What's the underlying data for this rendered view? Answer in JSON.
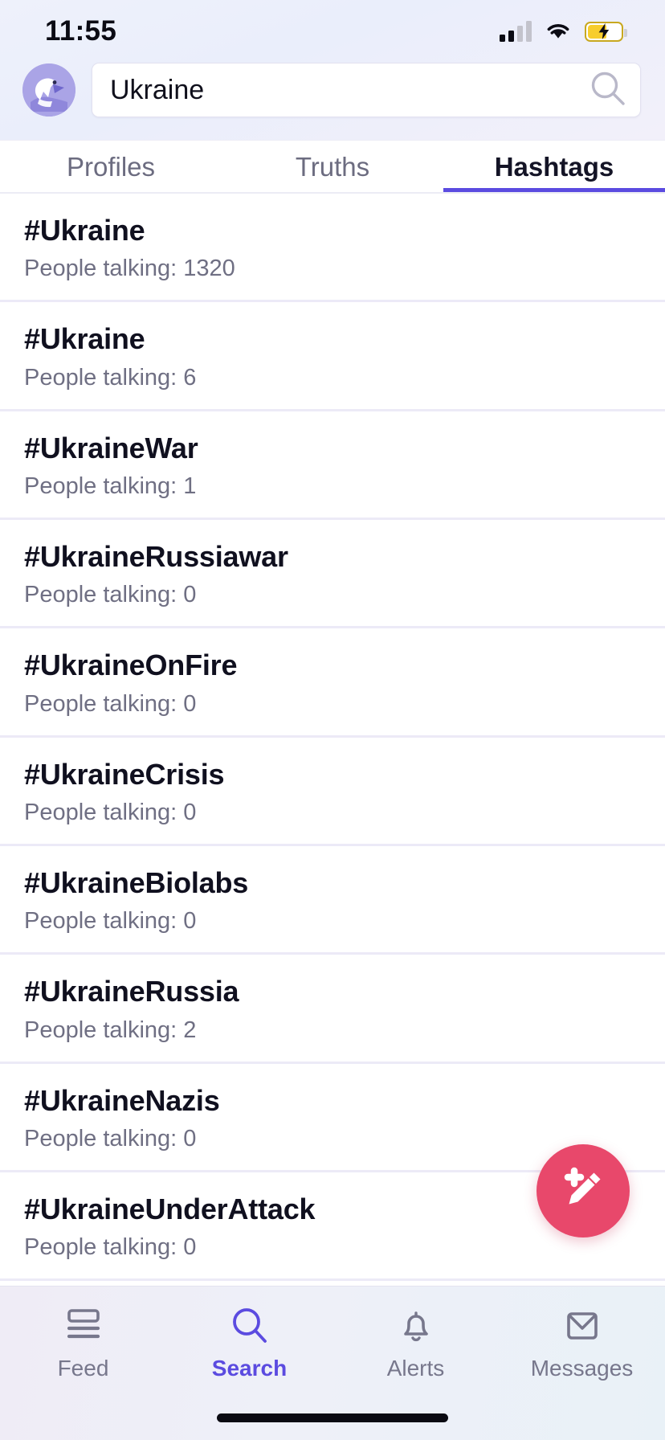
{
  "status_bar": {
    "time": "11:55",
    "signal_icon": "cellular-signal-icon",
    "wifi_icon": "wifi-icon",
    "battery_icon": "battery-charging-icon"
  },
  "header": {
    "avatar_icon": "eagle-avatar-icon",
    "search": {
      "value": "Ukraine",
      "placeholder": "Search",
      "icon": "search-icon"
    }
  },
  "tabs": [
    {
      "label": "Profiles",
      "active": false
    },
    {
      "label": "Truths",
      "active": false
    },
    {
      "label": "Hashtags",
      "active": true
    }
  ],
  "list": {
    "meta_prefix": "People talking: ",
    "items": [
      {
        "tag": "#Ukraine",
        "meta": "People talking: 1320",
        "count": "1320"
      },
      {
        "tag": "#Ukraine",
        "meta": "People talking: 6",
        "count": "6"
      },
      {
        "tag": "#UkraineWar",
        "meta": "People talking: 1",
        "count": "1"
      },
      {
        "tag": "#UkraineRussiawar",
        "meta": "People talking: 0",
        "count": "0"
      },
      {
        "tag": "#UkraineOnFire",
        "meta": "People talking: 0",
        "count": "0"
      },
      {
        "tag": "#UkraineCrisis",
        "meta": "People talking: 0",
        "count": "0"
      },
      {
        "tag": "#UkraineBiolabs",
        "meta": "People talking: 0",
        "count": "0"
      },
      {
        "tag": "#UkraineRussia",
        "meta": "People talking: 2",
        "count": "2"
      },
      {
        "tag": "#UkraineNazis",
        "meta": "People talking: 0",
        "count": "0"
      },
      {
        "tag": "#UkraineUnderAttack",
        "meta": "People talking: 0",
        "count": "0"
      }
    ]
  },
  "compose_button": {
    "icon": "compose-pencil-icon",
    "color": "#e8486b"
  },
  "bottom_nav": {
    "items": [
      {
        "label": "Feed",
        "icon": "feed-list-icon",
        "active": false
      },
      {
        "label": "Search",
        "icon": "search-icon",
        "active": true
      },
      {
        "label": "Alerts",
        "icon": "bell-icon",
        "active": false
      },
      {
        "label": "Messages",
        "icon": "envelope-icon",
        "active": false
      }
    ],
    "active_color": "#5b4be0",
    "inactive_color": "#77778c"
  },
  "home_indicator": "home-indicator"
}
